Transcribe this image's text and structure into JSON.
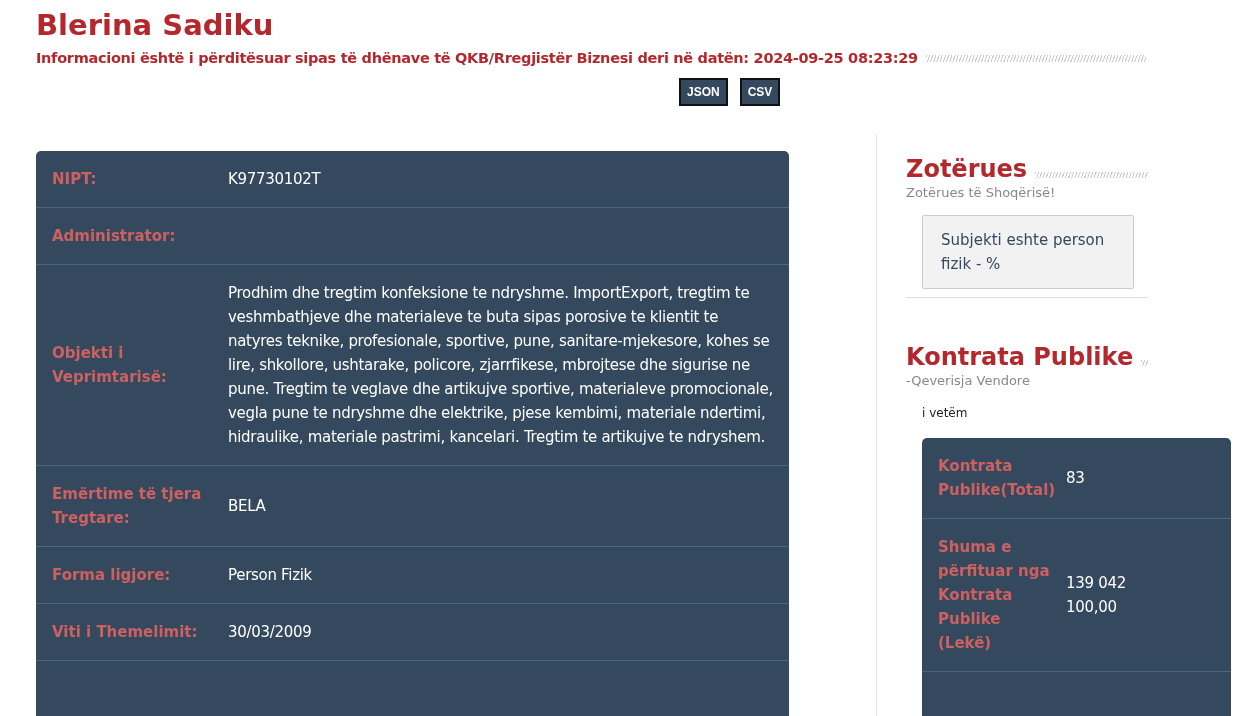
{
  "header": {
    "title": "Blerina Sadiku",
    "update_note": "Informacioni është i përditësuar sipas të dhënave të QKB/Rregjistër Biznesi deri në datën: 2024-09-25 08:23:29",
    "export_buttons": [
      "JSON",
      "CSV"
    ]
  },
  "details": [
    {
      "label": "NIPT:",
      "value": "K97730102T"
    },
    {
      "label": "Administrator:"
    },
    {
      "label": "Objekti i Veprimtarisë:",
      "value": "Prodhim dhe tregtim konfeksione te ndryshme. ImportExport, tregtim te veshmbathjeve dhe materialeve te buta sipas porosive te klientit te natyres teknike, profesionale, sportive, pune, sanitare-mjekesore, kohes se lire, shkollore, ushtarake, policore, zjarrfikese, mbrojtese dhe sigurise ne pune. Tregtim te veglave dhe artikujve sportive, materialeve promocionale, vegla pune te ndryshme dhe elektrike, pjese kembimi, materiale ndertimi, hidraulike, materiale pastrimi, kancelari. Tregtim te artikujve te ndryshem."
    },
    {
      "label": "Emërtime të tjera Tregtare:",
      "value": "BELA"
    },
    {
      "label": "Forma ligjore:",
      "value": "Person Fizik"
    },
    {
      "label": "Viti i Themelimit:",
      "value": "30/03/2009"
    }
  ],
  "owners": {
    "title": "Zotërues",
    "subtitle": "Zotërues të Shoqërisë!",
    "note": "Subjekti eshte person fizik - %"
  },
  "contracts": {
    "title": "Kontrata Publike",
    "subtitle": "-Qeverisja Vendore",
    "filter": "i vetëm",
    "rows": [
      {
        "label": "Kontrata Publike(Total)",
        "value": "83"
      },
      {
        "label": "Shuma e përfituar nga Kontrata Publike (Lekë)",
        "value": "139 042 100,00"
      }
    ]
  }
}
